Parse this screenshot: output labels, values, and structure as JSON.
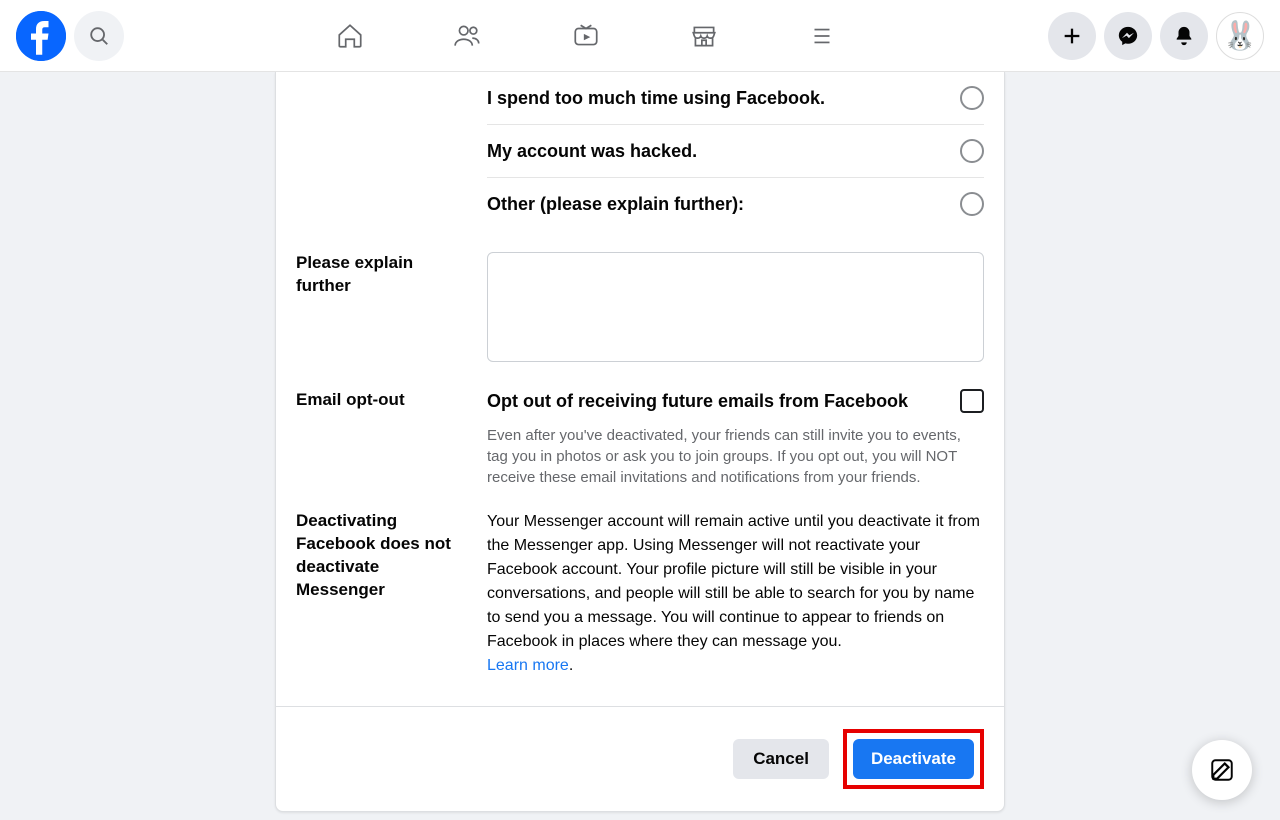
{
  "reasons": [
    {
      "label": "I spend too much time using Facebook."
    },
    {
      "label": "My account was hacked."
    },
    {
      "label": "Other (please explain further):"
    }
  ],
  "explain": {
    "label": "Please explain further",
    "value": ""
  },
  "optout": {
    "section_label": "Email opt-out",
    "title": "Opt out of receiving future emails from Facebook",
    "hint": "Even after you've deactivated, your friends can still invite you to events, tag you in photos or ask you to join groups. If you opt out, you will NOT receive these email invitations and notifications from your friends."
  },
  "messenger": {
    "section_label": "Deactivating Facebook does not deactivate Messenger",
    "body": "Your Messenger account will remain active until you deactivate it from the Messenger app. Using Messenger will not reactivate your Facebook account. Your profile picture will still be visible in your conversations, and people will still be able to search for you by name to send you a message. You will continue to appear to friends on Facebook in places where they can message you.",
    "learn_more": "Learn more"
  },
  "footer": {
    "cancel": "Cancel",
    "deactivate": "Deactivate"
  }
}
